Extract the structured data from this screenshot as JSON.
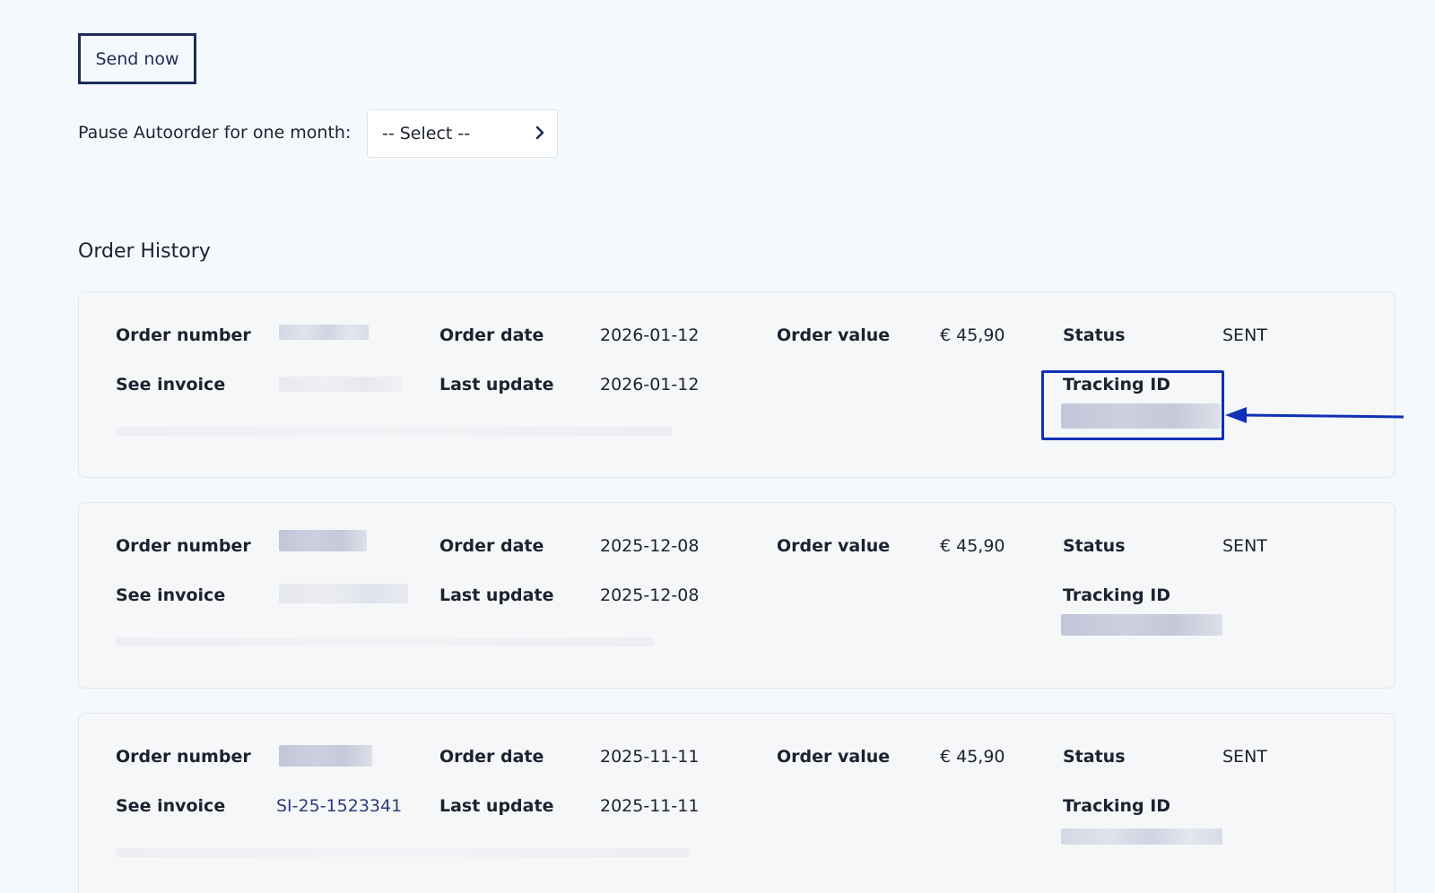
{
  "actions": {
    "send_now_label": "Send now",
    "pause_label": "Pause Autoorder for one month:",
    "pause_select_value": "-- Select --"
  },
  "order_history": {
    "title": "Order History",
    "labels": {
      "order_number": "Order number",
      "order_date": "Order date",
      "order_value": "Order value",
      "status": "Status",
      "see_invoice": "See invoice",
      "last_update": "Last update",
      "tracking_id": "Tracking ID"
    },
    "orders": [
      {
        "order_date": "2026-01-12",
        "order_value": "€ 45,90",
        "status": "SENT",
        "last_update": "2026-01-12",
        "invoice": ""
      },
      {
        "order_date": "2025-12-08",
        "order_value": "€ 45,90",
        "status": "SENT",
        "last_update": "2025-12-08",
        "invoice": ""
      },
      {
        "order_date": "2025-11-11",
        "order_value": "€ 45,90",
        "status": "SENT",
        "last_update": "2025-11-11",
        "invoice": "SI-25-1523341"
      }
    ]
  },
  "annotation": {
    "highlight_color": "#1030b8"
  },
  "icons": {
    "select_chevron": "chevron-right-icon",
    "annotation_arrow": "arrow-left-icon"
  }
}
